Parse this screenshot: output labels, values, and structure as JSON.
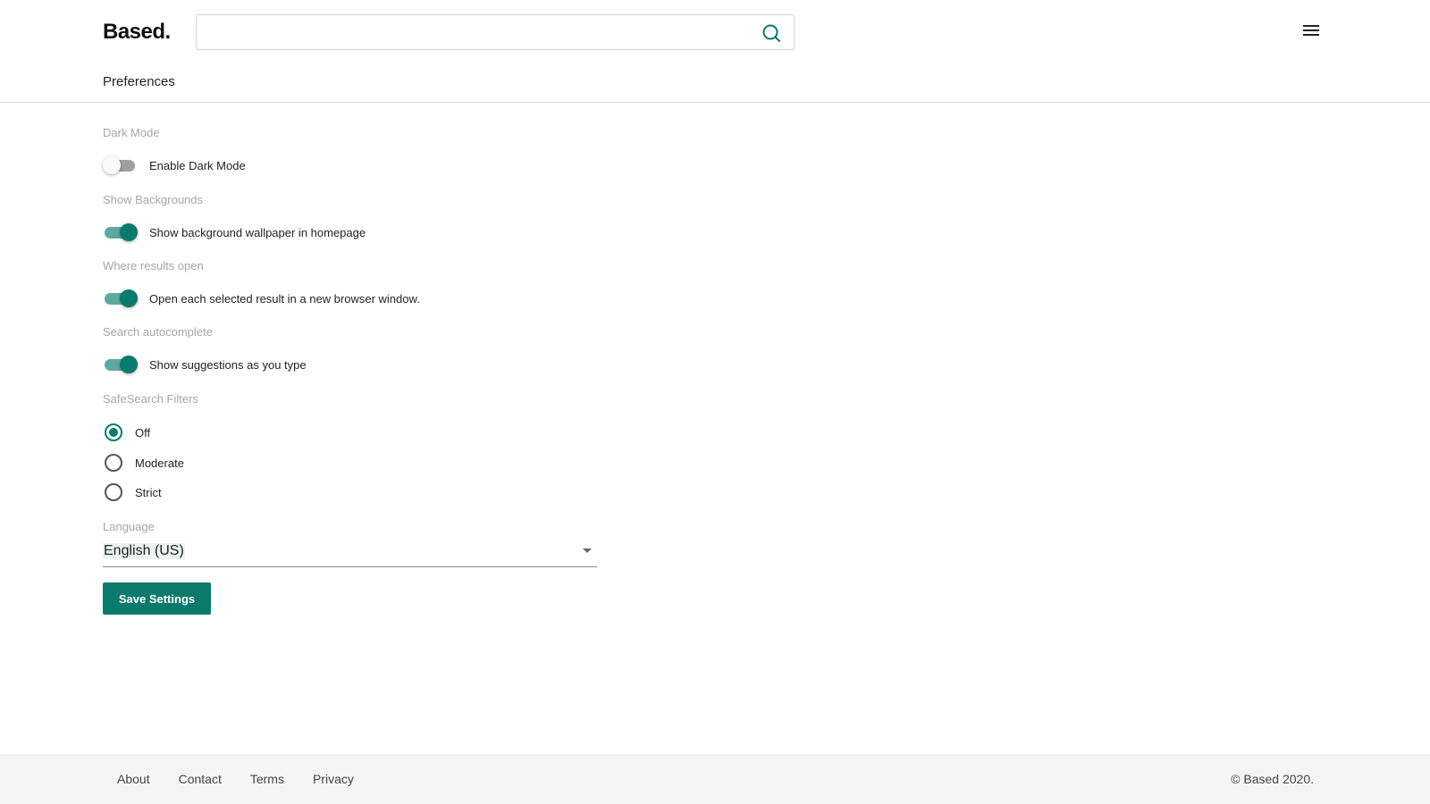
{
  "header": {
    "logo": "Based.",
    "search": {
      "value": "",
      "placeholder": ""
    },
    "page_title": "Preferences"
  },
  "settings": {
    "dark_mode": {
      "section": "Dark Mode",
      "label": "Enable Dark Mode",
      "enabled": false
    },
    "backgrounds": {
      "section": "Show Backgrounds",
      "label": "Show background wallpaper in homepage",
      "enabled": true
    },
    "results_open": {
      "section": "Where results open",
      "label": "Open each selected result in a new browser window.",
      "enabled": true
    },
    "autocomplete": {
      "section": "Search autocomplete",
      "label": "Show suggestions as you type",
      "enabled": true
    },
    "safesearch": {
      "section": "SafeSearch Filters",
      "options": [
        "Off",
        "Moderate",
        "Strict"
      ],
      "selected": "Off"
    },
    "language": {
      "section": "Language",
      "value": "English (US)"
    },
    "save_label": "Save Settings"
  },
  "footer": {
    "links": [
      "About",
      "Contact",
      "Terms",
      "Privacy"
    ],
    "copyright": "© Based 2020."
  },
  "colors": {
    "accent": "#0a7a6c",
    "accent_track": "#5fa8a0",
    "footer_bg": "#f5f5f5"
  }
}
